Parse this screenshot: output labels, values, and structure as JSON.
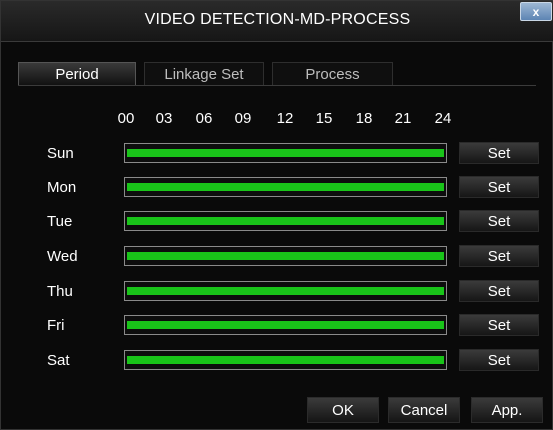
{
  "window": {
    "title": "VIDEO DETECTION-MD-PROCESS",
    "close_label": "x"
  },
  "tabs": [
    {
      "label": "Period",
      "active": true
    },
    {
      "label": "Linkage Set",
      "active": false
    },
    {
      "label": "Process",
      "active": false
    }
  ],
  "schedule": {
    "hours": [
      "00",
      "03",
      "06",
      "09",
      "12",
      "15",
      "18",
      "21",
      "24"
    ],
    "days": [
      {
        "label": "Sun",
        "set_label": "Set",
        "coverage": 1.0
      },
      {
        "label": "Mon",
        "set_label": "Set",
        "coverage": 1.0
      },
      {
        "label": "Tue",
        "set_label": "Set",
        "coverage": 1.0
      },
      {
        "label": "Wed",
        "set_label": "Set",
        "coverage": 1.0
      },
      {
        "label": "Thu",
        "set_label": "Set",
        "coverage": 1.0
      },
      {
        "label": "Fri",
        "set_label": "Set",
        "coverage": 1.0
      },
      {
        "label": "Sat",
        "set_label": "Set",
        "coverage": 1.0
      }
    ],
    "colors": {
      "active_period": "#19c419"
    }
  },
  "footer": {
    "ok_label": "OK",
    "cancel_label": "Cancel",
    "apply_label": "App."
  }
}
